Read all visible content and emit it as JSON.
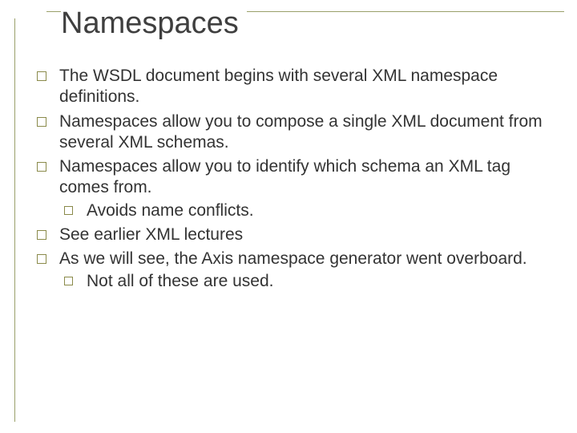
{
  "title": "Namespaces",
  "bullets": {
    "b1": "The WSDL document begins with several XML namespace definitions.",
    "b2": "Namespaces allow you to compose a single XML document from several XML schemas.",
    "b3": "Namespaces allow you to identify which schema an XML tag comes from.",
    "b3a": "Avoids name conflicts.",
    "b4": "See earlier XML lectures",
    "b5": "As we will see, the Axis namespace generator went overboard.",
    "b5a": "Not all of these are used."
  }
}
